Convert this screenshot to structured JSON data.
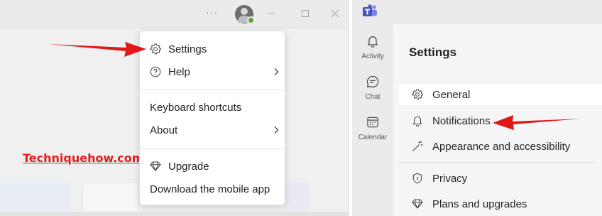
{
  "left": {
    "titlebar": {
      "more_label": "···",
      "icons": [
        "more-icon",
        "avatar",
        "minimize-icon",
        "maximize-icon",
        "close-icon"
      ]
    },
    "menu": {
      "items": [
        {
          "label": "Settings",
          "icon": "gear-icon"
        },
        {
          "label": "Help",
          "icon": "help-circle-icon",
          "has_submenu": true
        },
        {
          "label": "Keyboard shortcuts"
        },
        {
          "label": "About",
          "has_submenu": true
        },
        {
          "label": "Upgrade",
          "icon": "diamond-icon"
        },
        {
          "label": "Download the mobile app"
        }
      ]
    },
    "watermark": "Techniquehow.com"
  },
  "right": {
    "rail": [
      {
        "label": "Activity",
        "icon": "bell-icon"
      },
      {
        "label": "Chat",
        "icon": "chat-icon"
      },
      {
        "label": "Calendar",
        "icon": "calendar-icon"
      }
    ],
    "settings": {
      "title": "Settings",
      "items": [
        {
          "label": "General",
          "icon": "gear-icon",
          "active": true
        },
        {
          "label": "Notifications",
          "icon": "bell-icon"
        },
        {
          "label": "Appearance and accessibility",
          "icon": "magic-wand-icon"
        },
        {
          "label": "Privacy",
          "icon": "shield-icon"
        },
        {
          "label": "Plans and upgrades",
          "icon": "diamond-icon"
        }
      ]
    }
  },
  "colors": {
    "annotation_arrow": "#e01818",
    "teams_logo": "#5b5fc7",
    "status_available": "#5fa03f",
    "watermark": "#e21b1b"
  }
}
